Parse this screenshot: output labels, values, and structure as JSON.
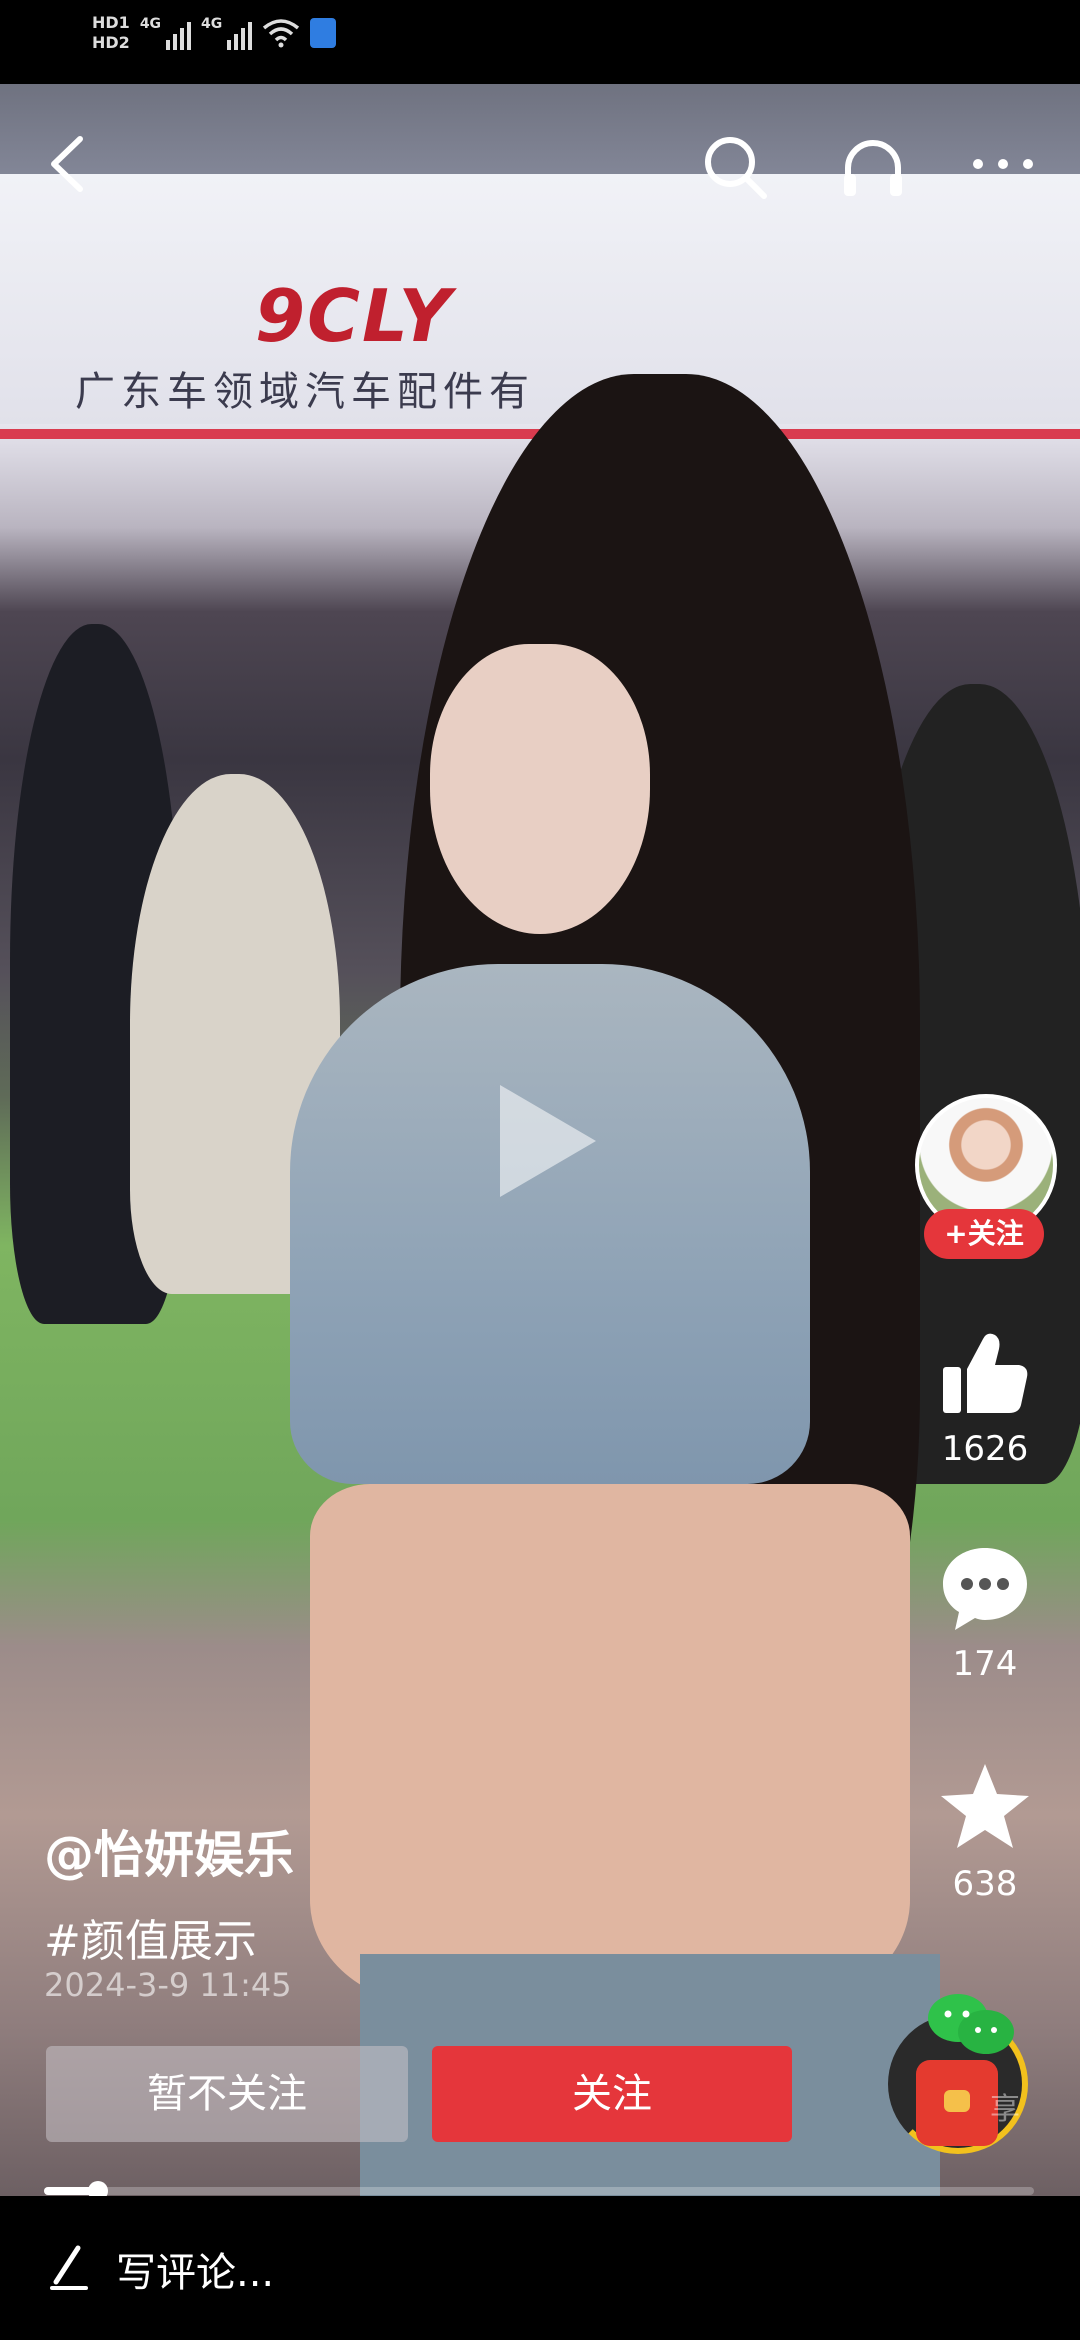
{
  "status_bar": {
    "hd1": "HD1",
    "hd2": "HD2",
    "net1": "4G",
    "net2": "4G"
  },
  "video": {
    "banner_logo": "9CLY",
    "banner_text": "广东车领域汽车配件有"
  },
  "nav": {
    "back_icon": "back-arrow-icon",
    "search_icon": "search-icon",
    "listen_icon": "headphones-icon",
    "more_icon": "more-icon"
  },
  "sidebar": {
    "follow_badge": "+关注",
    "like_count": "1626",
    "comment_count": "174",
    "favorite_count": "638"
  },
  "post": {
    "username": "@怡妍娱乐",
    "hashtag": "#颜值展示",
    "date": "2024-3-9 11:45"
  },
  "actions": {
    "skip_label": "暂不关注",
    "follow_label": "关注"
  },
  "share": {
    "label": "享"
  },
  "progress": {
    "fraction": 0.055
  },
  "comment_bar": {
    "placeholder": "写评论..."
  },
  "colors": {
    "accent": "#e5363b",
    "ring": "#f2c11d"
  }
}
